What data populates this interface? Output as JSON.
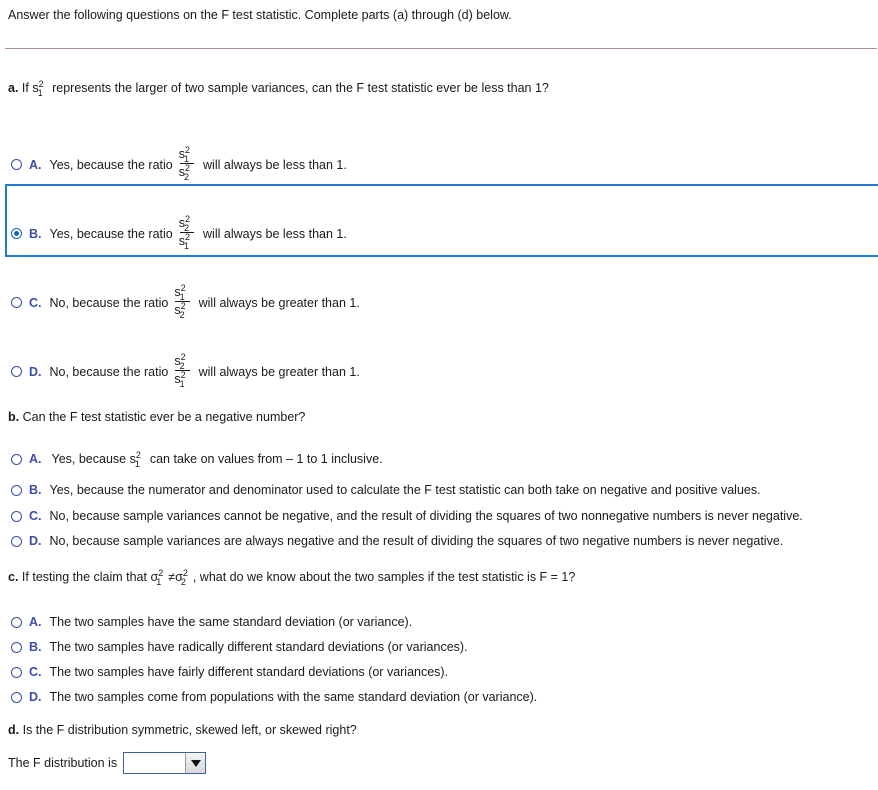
{
  "intro": {
    "text": "Answer the following questions on the F test statistic. Complete parts (a) through (d) below."
  },
  "parts": {
    "a": {
      "letter": "a.",
      "prompt_before": "If s",
      "prompt_sup": "2",
      "prompt_sub": "1",
      "prompt_after": "represents the larger of two sample variances, can the F test statistic ever be less than 1?",
      "options": [
        {
          "letter": "A.",
          "selected": false,
          "text_before": "Yes, because the ratio",
          "num_base": "s",
          "num_sup": "2",
          "num_sub": "1",
          "den_base": "s",
          "den_sup": "2",
          "den_sub": "2",
          "text_after": "will always be less than 1."
        },
        {
          "letter": "B.",
          "selected": true,
          "text_before": "Yes, because the ratio",
          "num_base": "s",
          "num_sup": "2",
          "num_sub": "2",
          "den_base": "s",
          "den_sup": "2",
          "den_sub": "1",
          "text_after": "will always be less than 1."
        },
        {
          "letter": "C.",
          "selected": false,
          "text_before": "No, because the ratio",
          "num_base": "s",
          "num_sup": "2",
          "num_sub": "1",
          "den_base": "s",
          "den_sup": "2",
          "den_sub": "2",
          "text_after": "will always be greater than 1."
        },
        {
          "letter": "D.",
          "selected": false,
          "text_before": "No, because the ratio",
          "num_base": "s",
          "num_sup": "2",
          "num_sub": "2",
          "den_base": "s",
          "den_sup": "2",
          "den_sub": "1",
          "text_after": "will always be greater than 1."
        }
      ]
    },
    "b": {
      "letter": "b.",
      "prompt": "Can the F test statistic ever be a negative number?",
      "option_a": {
        "letter": "A.",
        "selected": false,
        "text_before": "Yes, because s",
        "var_sup": "2",
        "var_sub": "1",
        "text_after": "can take on values from – 1 to 1 inclusive."
      },
      "options": [
        {
          "letter": "B.",
          "selected": false,
          "text": "Yes, because the numerator and denominator used to calculate the F test statistic can both take on negative and positive values."
        },
        {
          "letter": "C.",
          "selected": false,
          "text": "No, because sample variances cannot be negative, and the result of dividing the squares of two nonnegative numbers is never negative."
        },
        {
          "letter": "D.",
          "selected": false,
          "text": "No, because sample variances are always negative and the result of dividing the squares of two negative numbers is never negative."
        }
      ]
    },
    "c": {
      "letter": "c.",
      "prompt_before": "If testing the claim that",
      "sigma1_base": "σ",
      "sigma1_sup": "2",
      "sigma1_sub": "1",
      "neq": "≠",
      "sigma2_base": "σ",
      "sigma2_sup": "2",
      "sigma2_sub": "2",
      "prompt_after": ", what do we know about the two samples if the test statistic is F = 1?",
      "options": [
        {
          "letter": "A.",
          "selected": false,
          "text": "The two samples have the same standard deviation (or variance)."
        },
        {
          "letter": "B.",
          "selected": false,
          "text": "The two samples have radically different standard deviations (or variances)."
        },
        {
          "letter": "C.",
          "selected": false,
          "text": "The two samples have fairly different standard deviations (or variances)."
        },
        {
          "letter": "D.",
          "selected": false,
          "text": "The two samples come from populations with the same standard deviation (or variance)."
        }
      ]
    },
    "d": {
      "letter": "d.",
      "prompt": "Is the F distribution symmetric, skewed left, or skewed right?",
      "answer_label": "The F distribution is",
      "dropdown_value": "",
      "dropdown_icon": "caret-down-icon"
    }
  },
  "colors": {
    "option_letter": "#3b4ea8",
    "selected_radio": "#1565c0",
    "highlight_border": "#1e7ad4",
    "divider": "#a88ca0",
    "body_text": "#1a1a1a"
  }
}
